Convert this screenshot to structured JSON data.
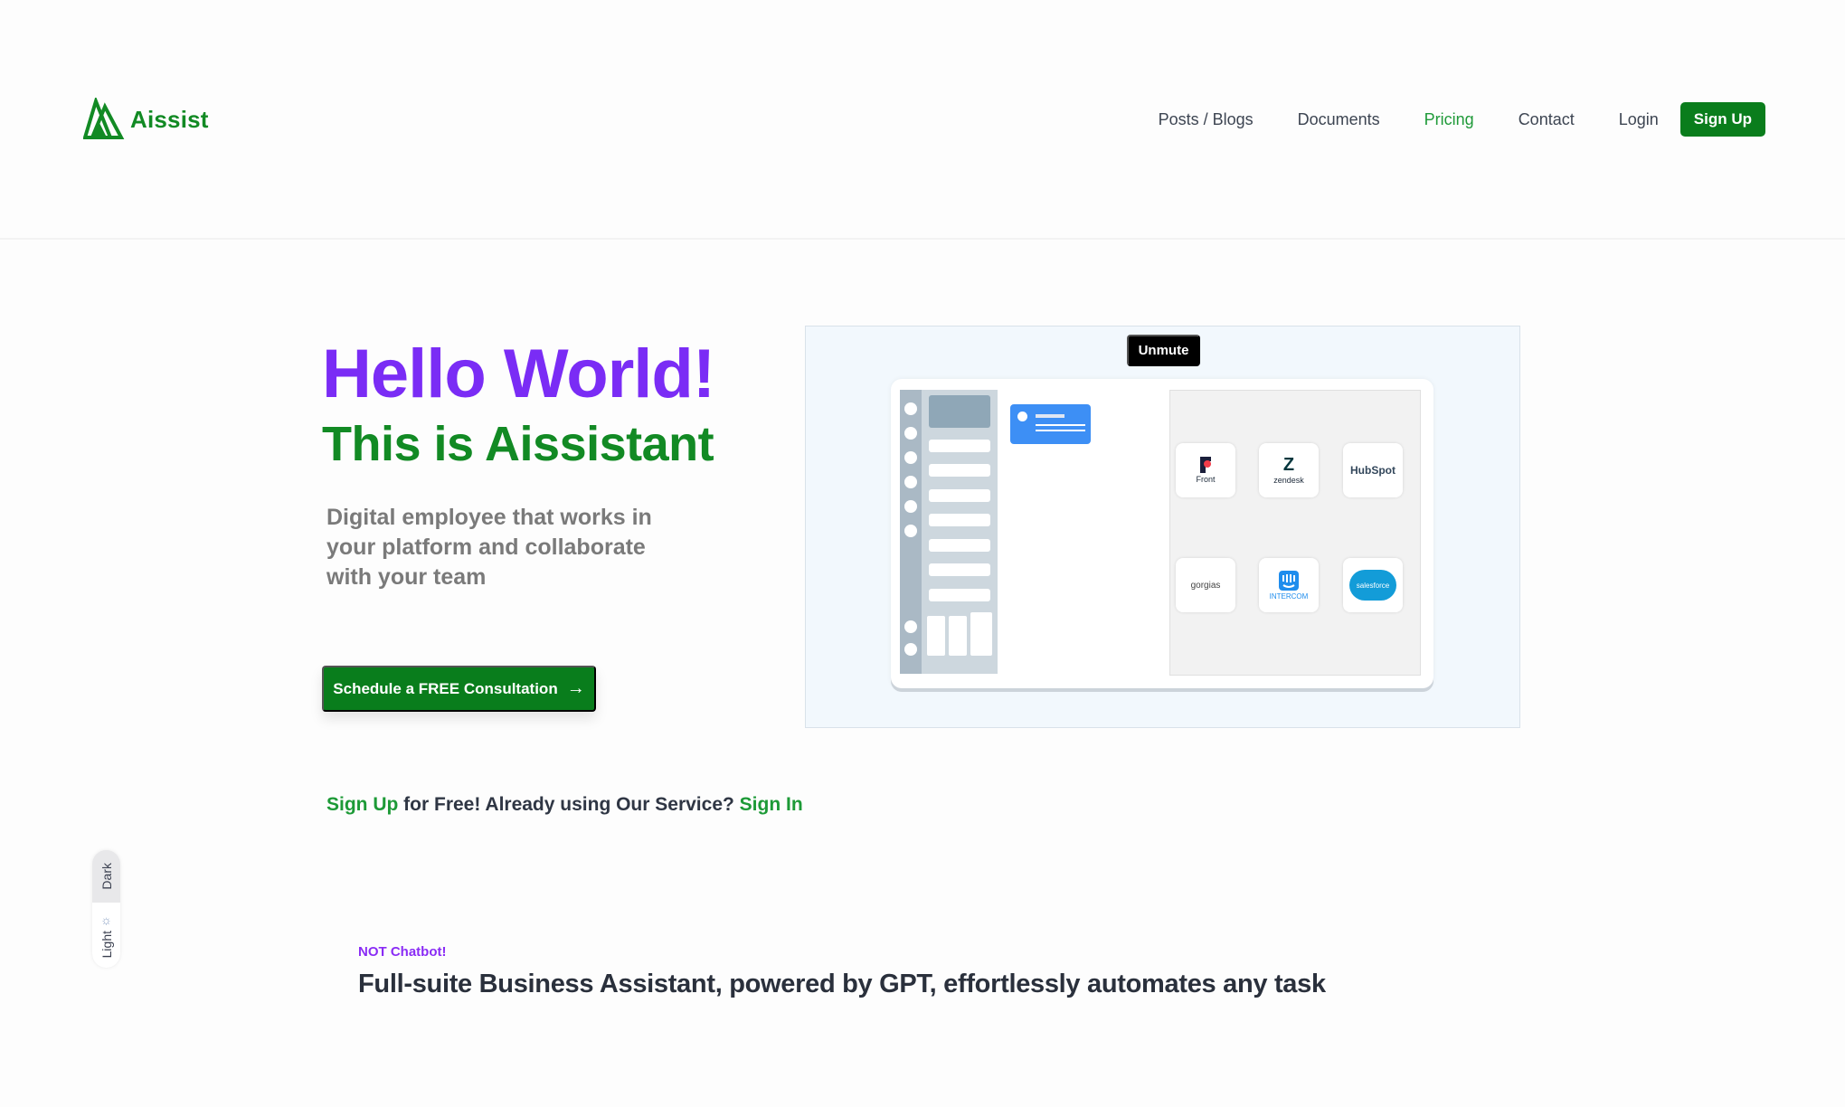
{
  "header": {
    "brand": "Aissist",
    "nav": [
      {
        "label": "Posts / Blogs",
        "active": false
      },
      {
        "label": "Documents",
        "active": false
      },
      {
        "label": "Pricing",
        "active": true
      },
      {
        "label": "Contact",
        "active": false
      },
      {
        "label": "Login",
        "active": false
      }
    ],
    "signup_label": "Sign Up"
  },
  "hero": {
    "title": "Hello World!",
    "subtitle": "This is Aissistant",
    "description": "Digital employee that works in your platform and collaborate with your team",
    "cta_label": "Schedule a FREE Consultation",
    "cta_icon": "arrow-right-icon",
    "signup_link": "Sign Up",
    "signup_text": " for Free! Already using Our Service? ",
    "signin_link": "Sign In"
  },
  "video": {
    "unmute_label": "Unmute",
    "integrations": [
      "Front",
      "zendesk",
      "HubSpot",
      "gorgias",
      "INTERCOM",
      "salesforce"
    ]
  },
  "theme_toggle": {
    "dark_label": "Dark",
    "light_label": "Light",
    "selected": "Light"
  },
  "feature": {
    "eyebrow": "NOT Chatbot!",
    "title": "Full-suite Business Assistant, powered by GPT, effortlessly automates any task"
  },
  "colors": {
    "brand_green": "#0a7d1c",
    "accent_purple": "#7a2cf5",
    "link_green": "#1d9a37"
  }
}
